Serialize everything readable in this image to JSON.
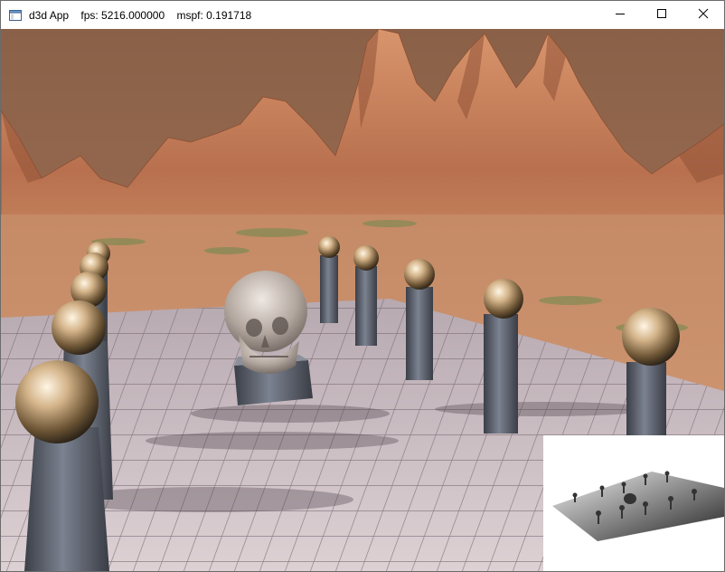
{
  "window": {
    "title": "d3d App    fps: 5216.000000    mspf: 0.191718",
    "icons": {
      "app": "application-window-icon",
      "minimize": "minimize-icon",
      "maximize": "maximize-icon",
      "close": "close-icon"
    }
  },
  "scene": {
    "sky_color": "#9a6a50",
    "terrain_color": "#c9825e",
    "floor_color": "#cfc2c6",
    "pillar_color": "#5e6470",
    "sphere_color": "#c8a878",
    "skull_color": "#bdb4ac"
  },
  "minimap": {
    "background": "#ffffff",
    "shadow_color": "#3a3a3a"
  }
}
